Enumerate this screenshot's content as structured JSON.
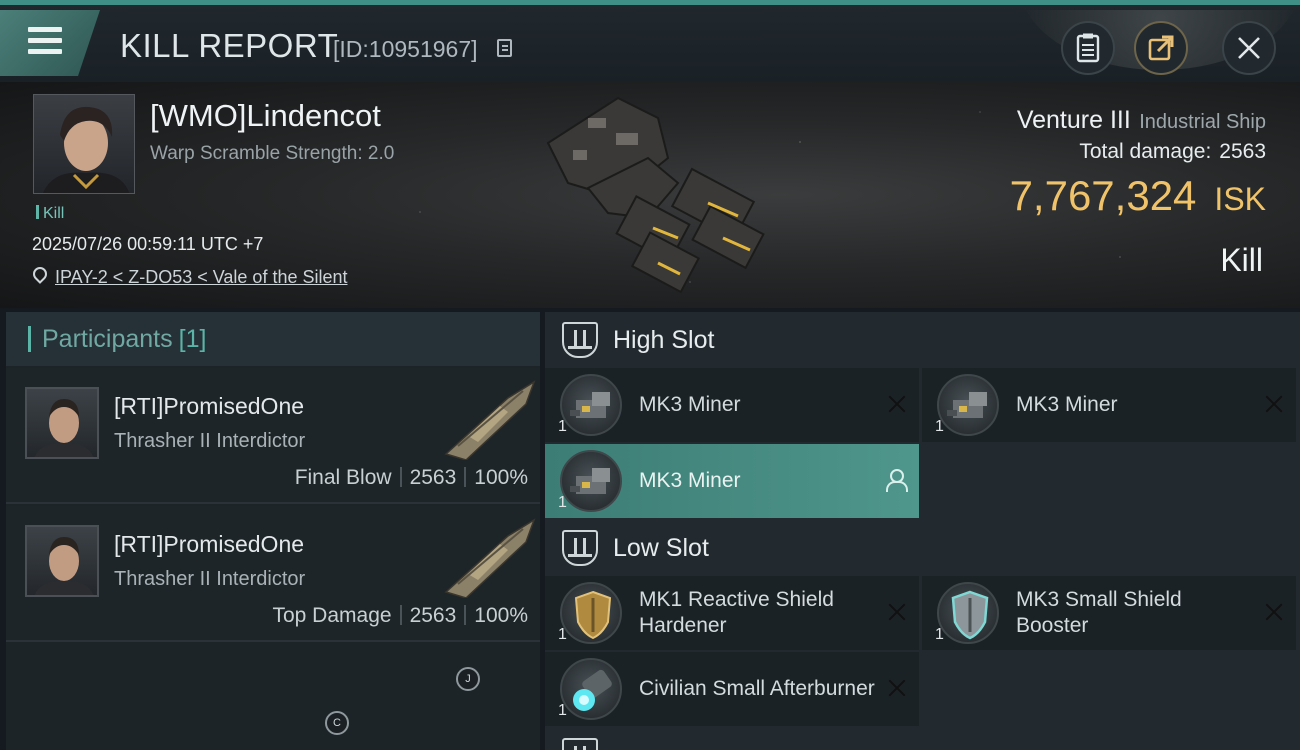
{
  "header": {
    "title": "KILL REPORT",
    "report_id": "[ID:10951967]"
  },
  "victim": {
    "name": "[WMO]Lindencot",
    "warp_scramble": "Warp Scramble Strength: 2.0",
    "kill_tag": "Kill",
    "datetime": "2025/07/26 00:59:11 UTC +7",
    "location": "IPAY-2 < Z-DO53 < Vale of the Silent",
    "ship_name": "Venture III",
    "ship_class": "Industrial Ship",
    "total_damage_label": "Total damage:",
    "total_damage": "2563",
    "isk_value": "7,767,324",
    "isk_unit": "ISK",
    "result": "Kill"
  },
  "participants": {
    "title": "Participants",
    "count": "[1]",
    "rows": [
      {
        "name": "[RTI]PromisedOne",
        "ship": "Thrasher II Interdictor",
        "role": "Final Blow",
        "damage": "2563",
        "percent": "100%"
      },
      {
        "name": "[RTI]PromisedOne",
        "ship": "Thrasher II Interdictor",
        "role": "Top Damage",
        "damage": "2563",
        "percent": "100%"
      }
    ],
    "markers": [
      "J",
      "C"
    ]
  },
  "fittings": {
    "high_slot": {
      "title": "High Slot",
      "items": [
        {
          "name": "MK3 Miner",
          "qty": "1"
        },
        {
          "name": "MK3 Miner",
          "qty": "1"
        },
        {
          "name": "MK3 Miner",
          "qty": "1"
        }
      ]
    },
    "low_slot": {
      "title": "Low Slot",
      "items": [
        {
          "name": "MK1 Reactive Shield Hardener",
          "qty": "1"
        },
        {
          "name": "MK3 Small Shield Booster",
          "qty": "1"
        },
        {
          "name": "Civilian Small Afterburner",
          "qty": "1"
        }
      ]
    }
  },
  "colors": {
    "accent_teal": "#5cb3a7",
    "isk_gold": "#f0c36a",
    "active_item": "#4f968c"
  },
  "icons": {
    "menu": "hamburger-icon",
    "copy": "copy-icon",
    "notes": "clipboard-icon",
    "share": "share-icon",
    "close": "close-icon",
    "location": "location-pin-icon",
    "slot": "slot-shield-icon",
    "remove": "x-icon",
    "owner": "person-icon"
  }
}
